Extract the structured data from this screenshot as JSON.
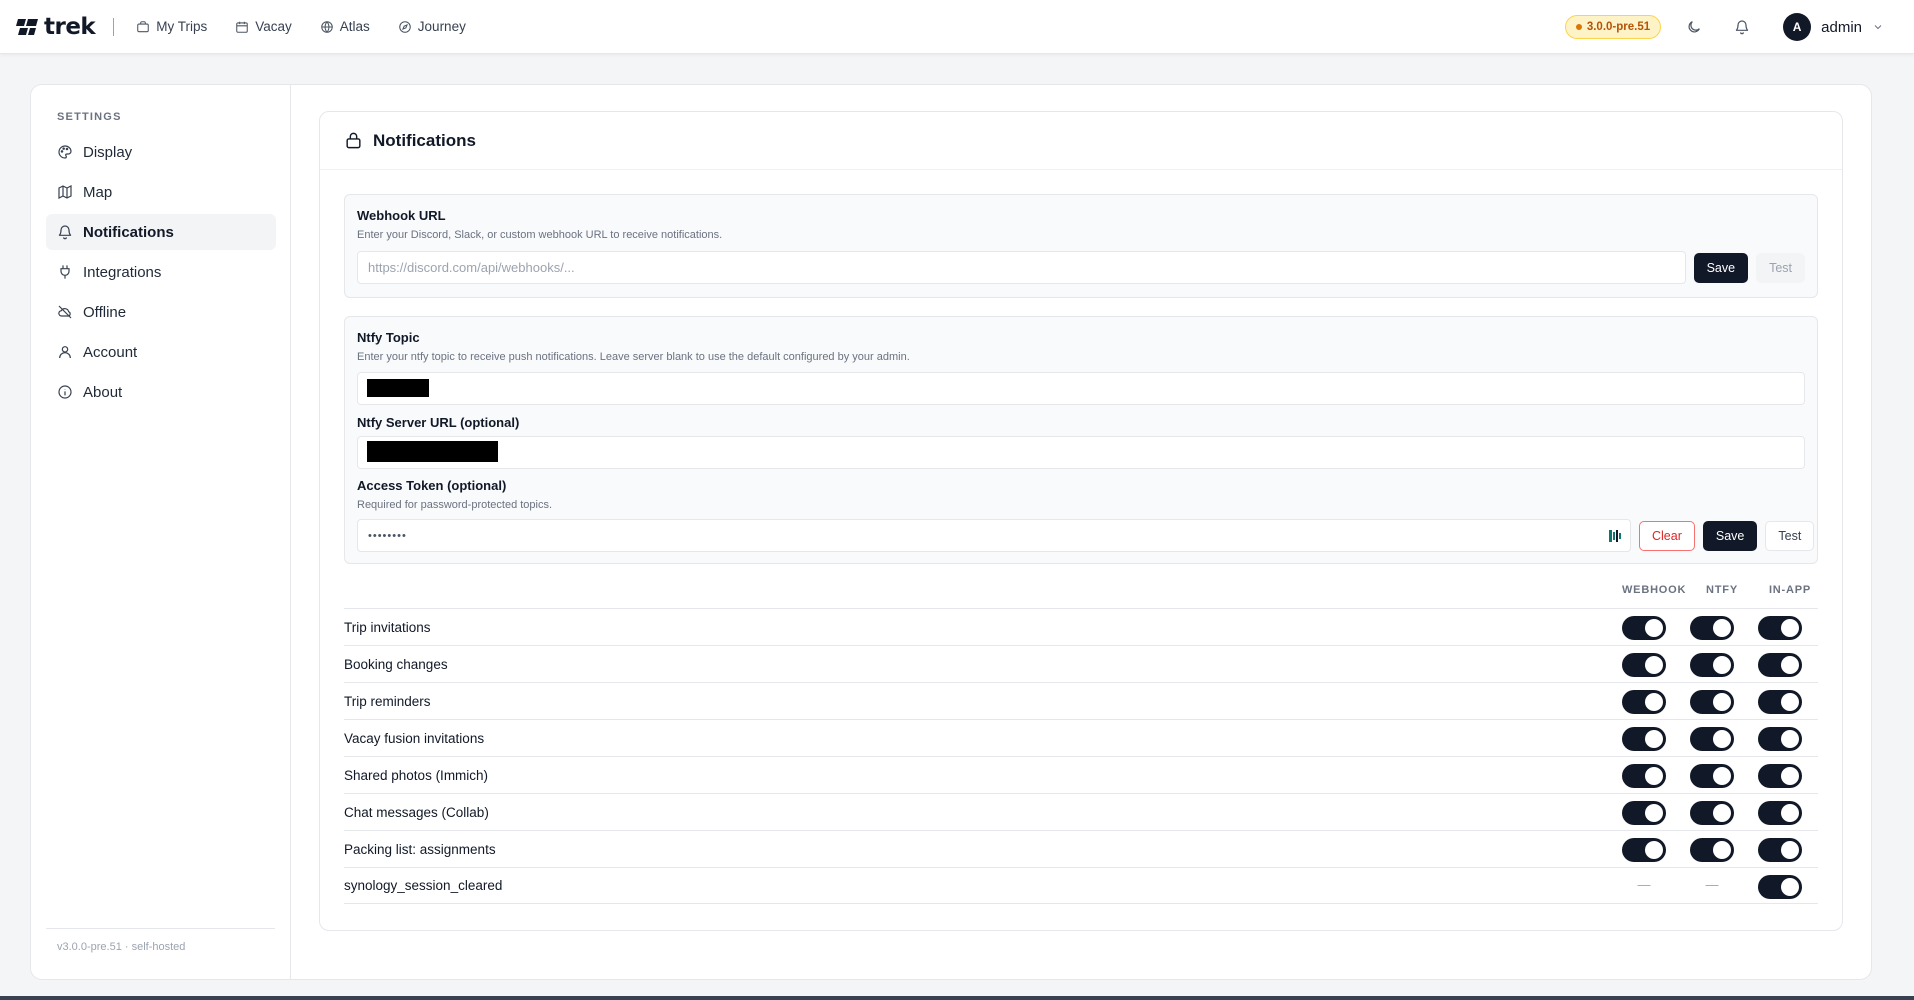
{
  "app": {
    "logo_text": "trek",
    "nav": [
      {
        "label": "My Trips",
        "icon": "briefcase-icon"
      },
      {
        "label": "Vacay",
        "icon": "calendar-icon"
      },
      {
        "label": "Atlas",
        "icon": "globe-icon"
      },
      {
        "label": "Journey",
        "icon": "compass-icon"
      }
    ],
    "version_badge": "3.0.0-pre.51",
    "user": {
      "initial": "A",
      "name": "admin"
    }
  },
  "sidebar": {
    "heading": "SETTINGS",
    "items": [
      {
        "label": "Display",
        "icon": "palette-icon",
        "active": false
      },
      {
        "label": "Map",
        "icon": "map-icon",
        "active": false
      },
      {
        "label": "Notifications",
        "icon": "bell-icon",
        "active": true
      },
      {
        "label": "Integrations",
        "icon": "plug-icon",
        "active": false
      },
      {
        "label": "Offline",
        "icon": "cloud-off-icon",
        "active": false
      },
      {
        "label": "Account",
        "icon": "user-icon",
        "active": false
      },
      {
        "label": "About",
        "icon": "info-icon",
        "active": false
      }
    ],
    "footer": "v3.0.0-pre.51 · self-hosted"
  },
  "notifications": {
    "title": "Notifications",
    "webhook": {
      "label": "Webhook URL",
      "description": "Enter your Discord, Slack, or custom webhook URL to receive notifications.",
      "placeholder": "https://discord.com/api/webhooks/...",
      "save_label": "Save",
      "test_label": "Test"
    },
    "ntfy": {
      "topic_label": "Ntfy Topic",
      "topic_description": "Enter your ntfy topic to receive push notifications. Leave server blank to use the default configured by your admin.",
      "server_label": "Ntfy Server URL (optional)",
      "token_label": "Access Token (optional)",
      "token_description": "Required for password-protected topics.",
      "token_value": "••••••••",
      "clear_label": "Clear",
      "save_label": "Save",
      "test_label": "Test"
    },
    "columns": [
      "WEBHOOK",
      "NTFY",
      "IN-APP"
    ],
    "events": [
      {
        "label": "Trip invitations",
        "webhook": true,
        "ntfy": true,
        "inapp": true
      },
      {
        "label": "Booking changes",
        "webhook": true,
        "ntfy": true,
        "inapp": true
      },
      {
        "label": "Trip reminders",
        "webhook": true,
        "ntfy": true,
        "inapp": true
      },
      {
        "label": "Vacay fusion invitations",
        "webhook": true,
        "ntfy": true,
        "inapp": true
      },
      {
        "label": "Shared photos (Immich)",
        "webhook": true,
        "ntfy": true,
        "inapp": true
      },
      {
        "label": "Chat messages (Collab)",
        "webhook": true,
        "ntfy": true,
        "inapp": true
      },
      {
        "label": "Packing list: assignments",
        "webhook": true,
        "ntfy": true,
        "inapp": true
      },
      {
        "label": "synology_session_cleared",
        "webhook": null,
        "ntfy": null,
        "inapp": true
      }
    ],
    "unavailable_mark": "—"
  },
  "colors": {
    "accent": "#111827",
    "badge_bg": "#fef3c7",
    "badge_text": "#b45309",
    "danger": "#dc2626"
  }
}
